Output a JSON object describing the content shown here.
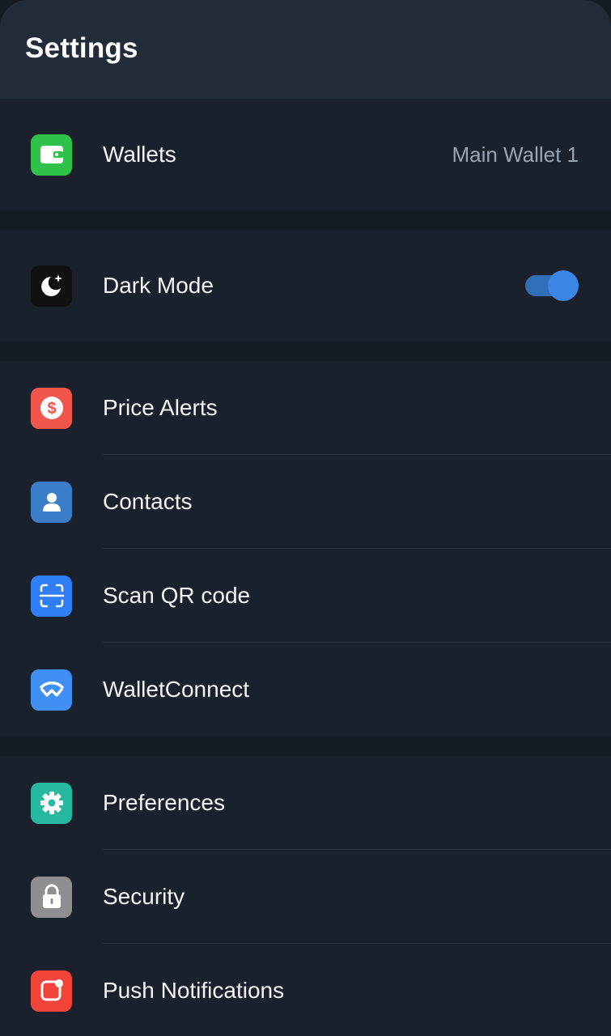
{
  "header": {
    "title": "Settings"
  },
  "colors": {
    "background": "#161c25",
    "header_bg": "#222c39",
    "row_bg": "#1b212c",
    "accent_blue": "#3b86e6"
  },
  "wallets_row": {
    "label": "Wallets",
    "value": "Main Wallet 1",
    "icon": "wallet-icon",
    "icon_color": "#2fc24a"
  },
  "dark_mode_row": {
    "label": "Dark Mode",
    "icon": "moon-icon",
    "icon_color": "#111111",
    "toggle_on": true
  },
  "group2": [
    {
      "label": "Price Alerts",
      "icon": "price-alert-icon",
      "icon_color": "#f0564b"
    },
    {
      "label": "Contacts",
      "icon": "contact-icon",
      "icon_color": "#3a7ec9"
    },
    {
      "label": "Scan QR code",
      "icon": "scan-icon",
      "icon_color": "#2f7ef5"
    },
    {
      "label": "WalletConnect",
      "icon": "walletconnect-icon",
      "icon_color": "#3f8ff4"
    }
  ],
  "group3": [
    {
      "label": "Preferences",
      "icon": "gear-icon",
      "icon_color": "#27b8a2"
    },
    {
      "label": "Security",
      "icon": "lock-icon",
      "icon_color": "#8e8e93"
    },
    {
      "label": "Push Notifications",
      "icon": "notification-icon",
      "icon_color": "#f0433a"
    }
  ]
}
